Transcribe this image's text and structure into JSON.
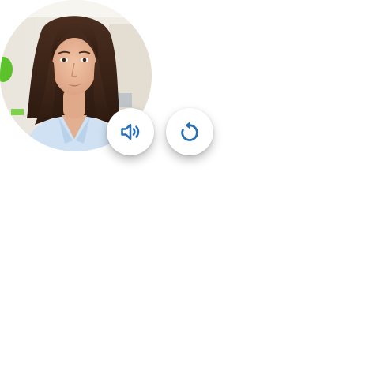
{
  "avatar": {
    "subject": "woman-portrait",
    "alt": ""
  },
  "controls": [
    {
      "id": "audio",
      "icon": "speaker-icon"
    },
    {
      "id": "replay",
      "icon": "replay-icon"
    }
  ],
  "colors": {
    "icon": "#2a6fb3",
    "button_bg": "#ffffff",
    "page_bg": "#ffffff",
    "accent_green": "#5cc22b"
  }
}
